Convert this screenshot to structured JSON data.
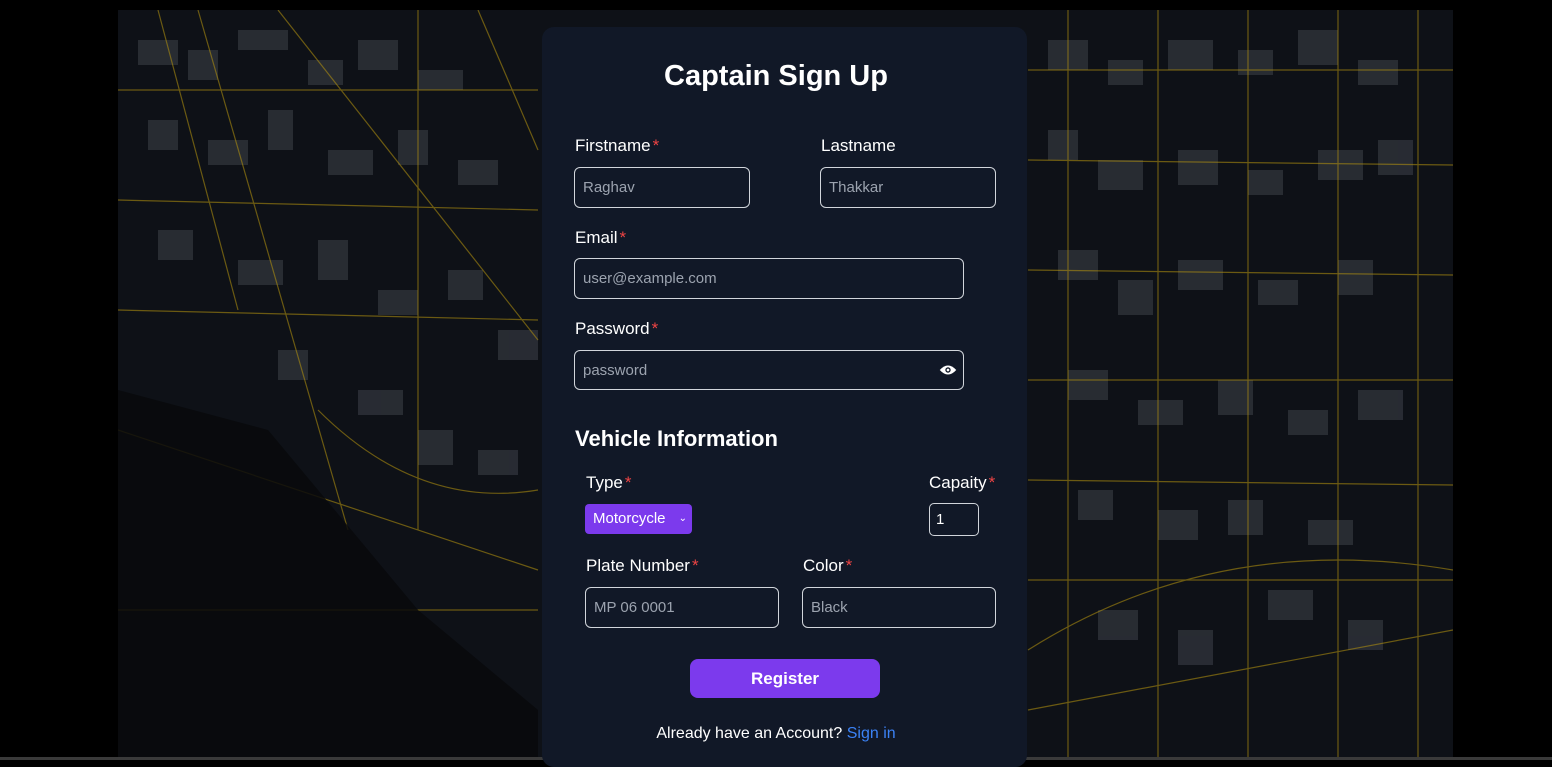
{
  "form": {
    "title": "Captain Sign Up",
    "firstname_label": "Firstname",
    "firstname_placeholder": "Raghav",
    "lastname_label": "Lastname",
    "lastname_placeholder": "Thakkar",
    "email_label": "Email",
    "email_placeholder": "user@example.com",
    "password_label": "Password",
    "password_placeholder": "password",
    "required_mark": "*"
  },
  "vehicle": {
    "section_title": "Vehicle Information",
    "type_label": "Type",
    "type_selected": "Motorcycle",
    "capacity_label": "Capaity",
    "capacity_value": "1",
    "plate_label": "Plate Number",
    "plate_placeholder": "MP 06 0001",
    "color_label": "Color",
    "color_placeholder": "Black"
  },
  "actions": {
    "register_label": "Register",
    "account_text": "Already have an Account?",
    "signin_label": "Sign in"
  },
  "icons": {
    "password_toggle": "eye-icon",
    "select_arrow": "chevron-down-icon"
  },
  "colors": {
    "card_bg": "#111827",
    "accent": "#7c3aed",
    "required": "#ef4444",
    "link": "#3b82f6",
    "map_roads": "#b8960f"
  }
}
